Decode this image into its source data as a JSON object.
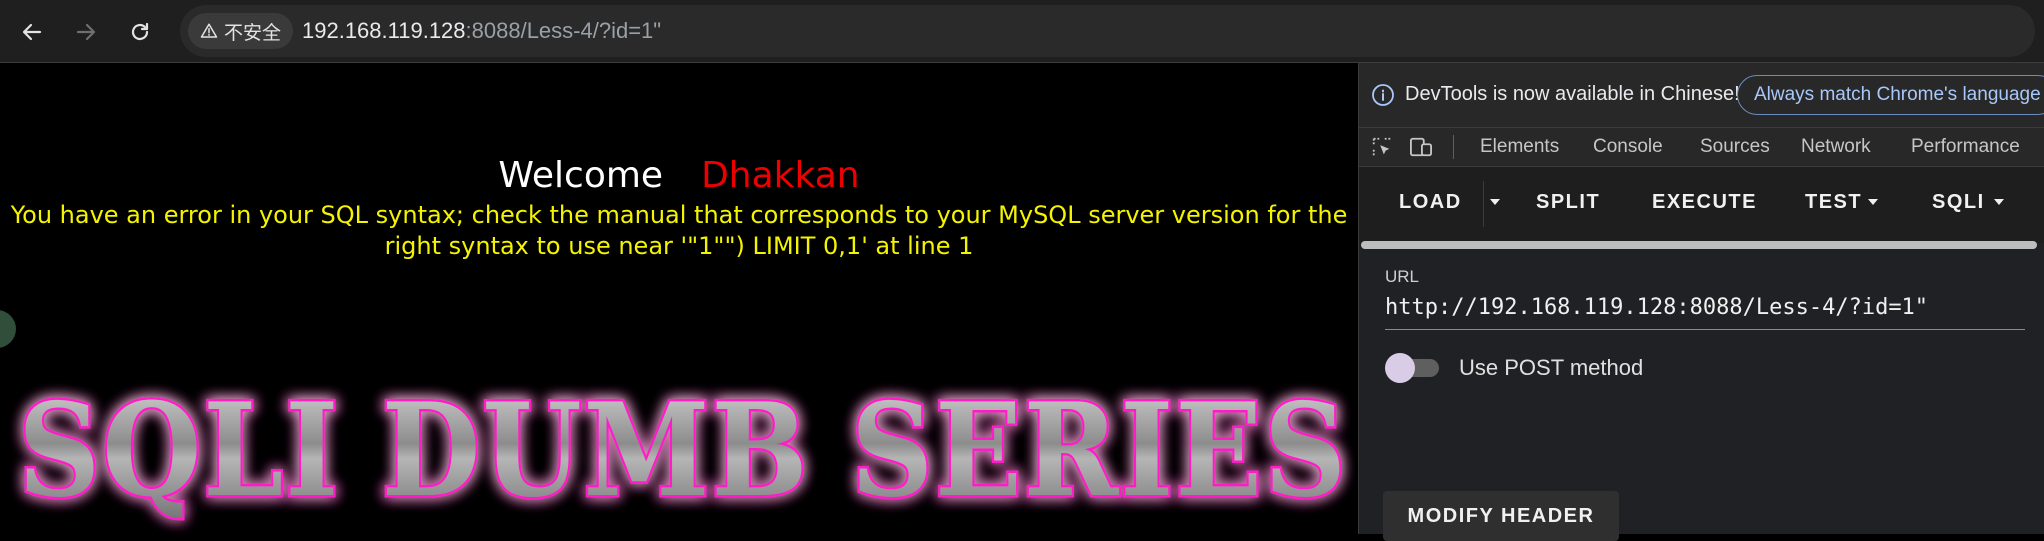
{
  "browser": {
    "security_label": "不安全",
    "url_host": "192.168.119.128",
    "url_rest": ":8088/Less-4/?id=1\""
  },
  "page": {
    "welcome_label": "Welcome",
    "welcome_name": "Dhakkan",
    "error_message": "You have an error in your SQL syntax; check the manual that corresponds to your MySQL server version for the right syntax to use near '\"1\"\") LIMIT 0,1' at line 1",
    "banner_text": "SQLI DUMB SERIES"
  },
  "devtools": {
    "info_text": "DevTools is now available in Chinese!",
    "lang_button": "Always match Chrome's language",
    "tabs": [
      "Elements",
      "Console",
      "Sources",
      "Network",
      "Performance"
    ],
    "hackbar": {
      "buttons": [
        "LOAD",
        "SPLIT",
        "EXECUTE",
        "TEST",
        "SQLI"
      ],
      "url_label": "URL",
      "url_value": "http://192.168.119.128:8088/Less-4/?id=1\"",
      "post_label": "Use POST method",
      "post_enabled": false,
      "modify_header": "MODIFY HEADER"
    }
  },
  "colors": {
    "banner_glow": "#ff1fc8",
    "error_text": "#f4f400",
    "name_text": "#ee0000"
  }
}
